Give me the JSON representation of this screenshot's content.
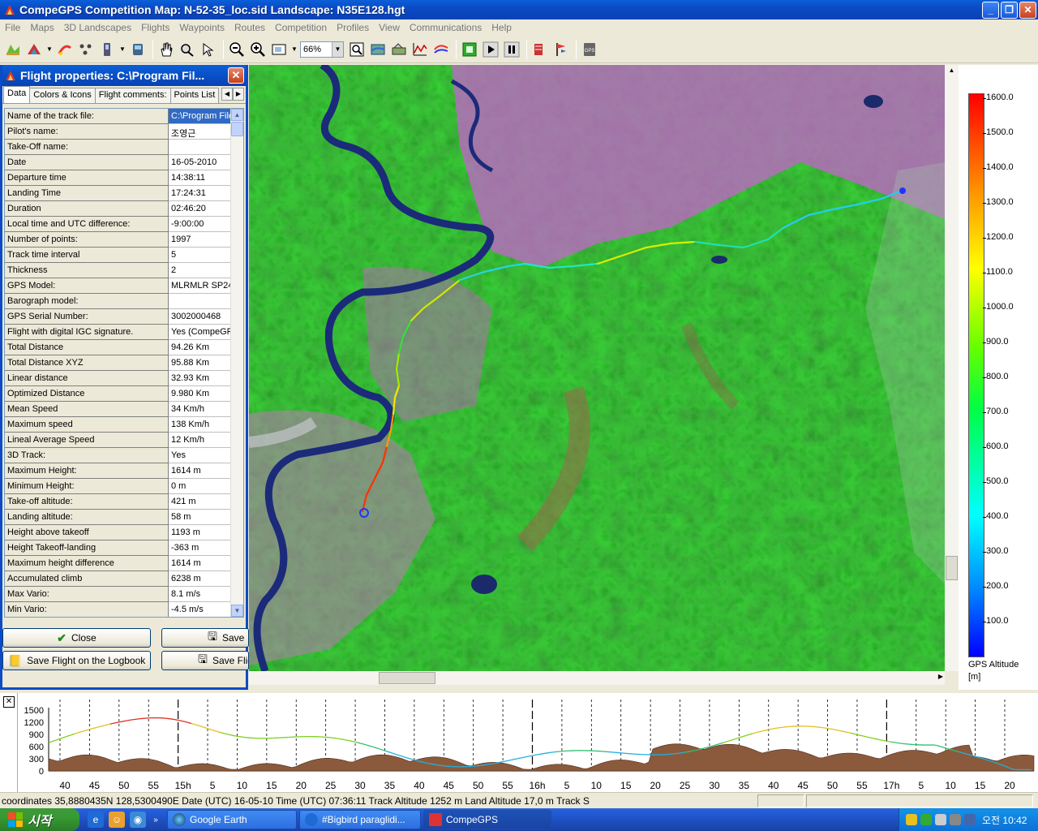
{
  "window": {
    "title": "CompeGPS Competition Map: N-52-35_loc.sid Landscape: N35E128.hgt"
  },
  "menu": [
    "File",
    "Maps",
    "3D Landscapes",
    "Flights",
    "Waypoints",
    "Routes",
    "Competition",
    "Profiles",
    "View",
    "Communications",
    "Help"
  ],
  "toolbar": {
    "zoom_value": "66%"
  },
  "panel": {
    "title": "Flight properties: C:\\Program Fil...",
    "tabs": [
      "Data",
      "Colors & Icons",
      "Flight comments:",
      "Points List"
    ],
    "active_tab": "Data",
    "rows": [
      {
        "label": "Name of the track file:",
        "value": "C:\\Program Files"
      },
      {
        "label": "Pilot's name:",
        "value": "조영근"
      },
      {
        "label": "Take-Off name:",
        "value": ""
      },
      {
        "label": "Date",
        "value": "16-05-2010"
      },
      {
        "label": "Departure time",
        "value": "14:38:11"
      },
      {
        "label": "Landing Time",
        "value": "17:24:31"
      },
      {
        "label": "Duration",
        "value": "02:46:20"
      },
      {
        "label": "Local time and UTC difference:",
        "value": "-9:00:00"
      },
      {
        "label": "Number of points:",
        "value": "1997"
      },
      {
        "label": "Track time interval",
        "value": "5"
      },
      {
        "label": "Thickness",
        "value": "2"
      },
      {
        "label": "GPS Model:",
        "value": "MLRMLR SP24"
      },
      {
        "label": "Barograph model:",
        "value": ""
      },
      {
        "label": "GPS Serial Number:",
        "value": "3002000468"
      },
      {
        "label": "Flight with digital IGC signature.",
        "value": "Yes (CompeGPS"
      },
      {
        "label": "Total Distance",
        "value": "94.26 Km"
      },
      {
        "label": "Total Distance XYZ",
        "value": "95.88 Km"
      },
      {
        "label": "Linear distance",
        "value": "32.93 Km"
      },
      {
        "label": "Optimized Distance",
        "value": "9.980 Km"
      },
      {
        "label": "Mean Speed",
        "value": "34 Km/h"
      },
      {
        "label": "Maximum speed",
        "value": "138 Km/h"
      },
      {
        "label": "Lineal Average Speed",
        "value": "12 Km/h"
      },
      {
        "label": "3D Track:",
        "value": "Yes"
      },
      {
        "label": "Maximum Height:",
        "value": "1614 m"
      },
      {
        "label": "Minimum Height:",
        "value": "0 m"
      },
      {
        "label": "Take-off altitude:",
        "value": "421 m"
      },
      {
        "label": "Landing altitude:",
        "value": "58 m"
      },
      {
        "label": "Height above takeoff",
        "value": "1193 m"
      },
      {
        "label": "Height Takeoff-landing",
        "value": "-363 m"
      },
      {
        "label": "Maximum height difference",
        "value": "1614 m"
      },
      {
        "label": "Accumulated climb",
        "value": "6238 m"
      },
      {
        "label": "Max Vario:",
        "value": "8.1 m/s"
      },
      {
        "label": "Min Vario:",
        "value": "-4.5 m/s"
      }
    ],
    "buttons": {
      "close": "Close",
      "save": "Save",
      "save_logbook": "Save Flight on the Logbook",
      "save_flight": "Save Flig"
    }
  },
  "legend": {
    "ticks": [
      "1600.0",
      "1500.0",
      "1400.0",
      "1300.0",
      "1200.0",
      "1100.0",
      "1000.0",
      "900.0",
      "800.0",
      "700.0",
      "600.0",
      "500.0",
      "400.0",
      "300.0",
      "200.0",
      "100.0"
    ],
    "title_line1": "GPS Altitude",
    "title_line2": "[m]"
  },
  "profile": {
    "y_ticks": [
      "1500",
      "1200",
      "900",
      "600",
      "300",
      "0"
    ],
    "x_ticks": [
      "40",
      "45",
      "50",
      "55",
      "15h",
      "5",
      "10",
      "15",
      "20",
      "25",
      "30",
      "35",
      "40",
      "45",
      "50",
      "55",
      "16h",
      "5",
      "10",
      "15",
      "20",
      "25",
      "30",
      "35",
      "40",
      "45",
      "50",
      "55",
      "17h",
      "5",
      "10",
      "15",
      "20"
    ]
  },
  "status": {
    "text": "coordinates 35,8880435N 128,5300490E Date (UTC) 16-05-10 Time (UTC) 07:36:11 Track Altitude 1252 m Land Altitude 17,0 m Track S"
  },
  "taskbar": {
    "start": "시작",
    "tasks": [
      "Google Earth",
      "#Bigbird paraglidi...",
      "CompeGPS"
    ],
    "clock": "오전 10:42"
  },
  "colors": {
    "xp_blue": "#0b4bc5",
    "track_high": "#ff0000",
    "track_low": "#0000ff"
  }
}
